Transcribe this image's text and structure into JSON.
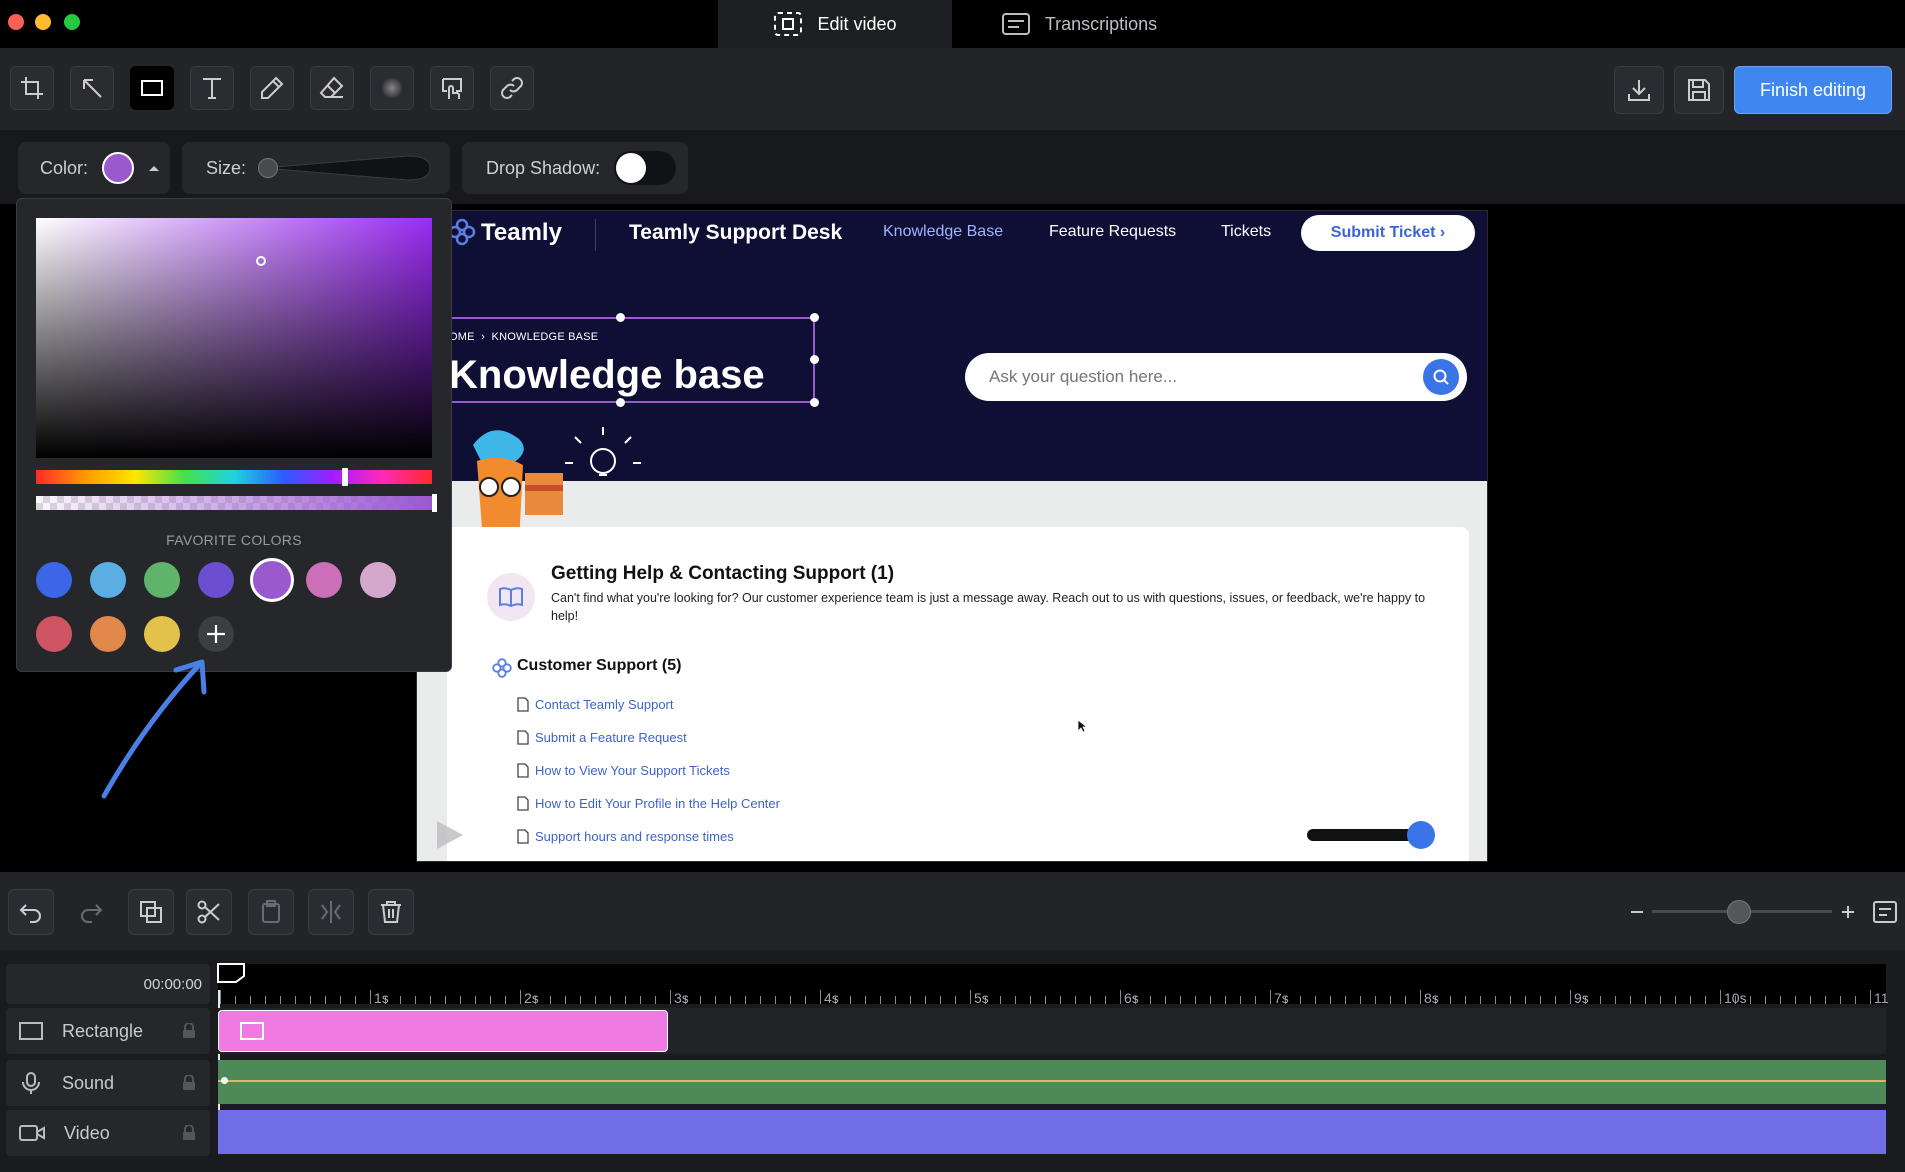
{
  "window": {
    "tabs": [
      {
        "label": "Edit video",
        "icon": "select-frame-icon",
        "active": true
      },
      {
        "label": "Transcriptions",
        "icon": "transcript-icon",
        "active": false
      }
    ]
  },
  "toolbar": {
    "tools": [
      "crop-icon",
      "arrow-icon",
      "rectangle-icon",
      "text-icon",
      "pen-icon",
      "eraser-icon",
      "blur-icon",
      "click-icon",
      "link-icon"
    ],
    "active_tool": "rectangle-icon",
    "finish_label": "Finish editing"
  },
  "options": {
    "color_label": "Color:",
    "selected_color": "#9b59d0",
    "size_label": "Size:",
    "size_value": 0,
    "shadow_label": "Drop Shadow:",
    "shadow_on": false
  },
  "picker": {
    "favorites_label": "FAVORITE COLORS",
    "favorites": [
      "#3b66e6",
      "#5aaee3",
      "#5fb36a",
      "#6b4fd0",
      "#9b59d0",
      "#cb6fb8",
      "#d6a7cd",
      "#cf5562",
      "#e0874a",
      "#e2c24a"
    ],
    "selected_index": 4
  },
  "site": {
    "brand": "Teamly",
    "desk_title": "Teamly Support Desk",
    "nav": [
      "Knowledge Base",
      "Feature Requests",
      "Tickets"
    ],
    "submit": "Submit Ticket ›",
    "breadcrumb": "HOME  ›  KNOWLEDGE BASE",
    "breadcrumb_visible": "OME  ›  KNOWLEDGE BASE",
    "heading": "Knowledge base",
    "search_placeholder": "Ask your question here...",
    "section1_title": "Getting Help & Contacting Support (1)",
    "section1_desc": "Can't find what you're looking for? Our customer experience team is just a message away. Reach out to us with questions, issues, or feedback, we're happy to help!",
    "section2_title": "Customer Support (5)",
    "links": [
      "Contact Teamly Support",
      "Submit a Feature Request",
      "How to View Your Support Tickets",
      "How to Edit Your Profile in the Help Center",
      "Support hours and response times"
    ]
  },
  "playback": {
    "volume": 0.9
  },
  "timeline": {
    "timecode": "00:00:00",
    "ticks": [
      "1s",
      "2s",
      "3s",
      "4s",
      "5s",
      "6s",
      "7s",
      "8s",
      "9s",
      "10s",
      "11"
    ],
    "zoom": 0.5,
    "tracks": [
      {
        "name": "Rectangle",
        "icon": "rectangle-icon"
      },
      {
        "name": "Sound",
        "icon": "microphone-icon"
      },
      {
        "name": "Video",
        "icon": "video-icon"
      }
    ],
    "colors": {
      "rectangle": "#ee79e0",
      "sound": "#4e8a57",
      "video": "#6f6ee6"
    }
  }
}
